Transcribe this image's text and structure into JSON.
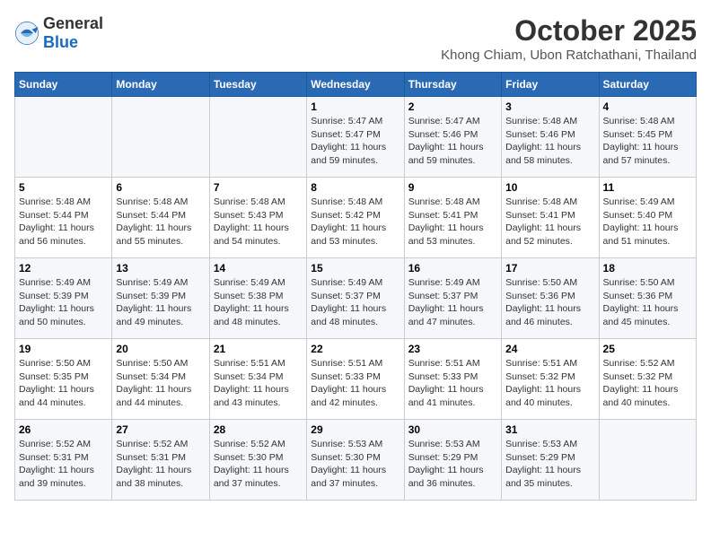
{
  "logo": {
    "general": "General",
    "blue": "Blue"
  },
  "title": "October 2025",
  "subtitle": "Khong Chiam, Ubon Ratchathani, Thailand",
  "headers": [
    "Sunday",
    "Monday",
    "Tuesday",
    "Wednesday",
    "Thursday",
    "Friday",
    "Saturday"
  ],
  "weeks": [
    [
      {
        "day": "",
        "info": ""
      },
      {
        "day": "",
        "info": ""
      },
      {
        "day": "",
        "info": ""
      },
      {
        "day": "1",
        "info": "Sunrise: 5:47 AM\nSunset: 5:47 PM\nDaylight: 11 hours\nand 59 minutes."
      },
      {
        "day": "2",
        "info": "Sunrise: 5:47 AM\nSunset: 5:46 PM\nDaylight: 11 hours\nand 59 minutes."
      },
      {
        "day": "3",
        "info": "Sunrise: 5:48 AM\nSunset: 5:46 PM\nDaylight: 11 hours\nand 58 minutes."
      },
      {
        "day": "4",
        "info": "Sunrise: 5:48 AM\nSunset: 5:45 PM\nDaylight: 11 hours\nand 57 minutes."
      }
    ],
    [
      {
        "day": "5",
        "info": "Sunrise: 5:48 AM\nSunset: 5:44 PM\nDaylight: 11 hours\nand 56 minutes."
      },
      {
        "day": "6",
        "info": "Sunrise: 5:48 AM\nSunset: 5:44 PM\nDaylight: 11 hours\nand 55 minutes."
      },
      {
        "day": "7",
        "info": "Sunrise: 5:48 AM\nSunset: 5:43 PM\nDaylight: 11 hours\nand 54 minutes."
      },
      {
        "day": "8",
        "info": "Sunrise: 5:48 AM\nSunset: 5:42 PM\nDaylight: 11 hours\nand 53 minutes."
      },
      {
        "day": "9",
        "info": "Sunrise: 5:48 AM\nSunset: 5:41 PM\nDaylight: 11 hours\nand 53 minutes."
      },
      {
        "day": "10",
        "info": "Sunrise: 5:48 AM\nSunset: 5:41 PM\nDaylight: 11 hours\nand 52 minutes."
      },
      {
        "day": "11",
        "info": "Sunrise: 5:49 AM\nSunset: 5:40 PM\nDaylight: 11 hours\nand 51 minutes."
      }
    ],
    [
      {
        "day": "12",
        "info": "Sunrise: 5:49 AM\nSunset: 5:39 PM\nDaylight: 11 hours\nand 50 minutes."
      },
      {
        "day": "13",
        "info": "Sunrise: 5:49 AM\nSunset: 5:39 PM\nDaylight: 11 hours\nand 49 minutes."
      },
      {
        "day": "14",
        "info": "Sunrise: 5:49 AM\nSunset: 5:38 PM\nDaylight: 11 hours\nand 48 minutes."
      },
      {
        "day": "15",
        "info": "Sunrise: 5:49 AM\nSunset: 5:37 PM\nDaylight: 11 hours\nand 48 minutes."
      },
      {
        "day": "16",
        "info": "Sunrise: 5:49 AM\nSunset: 5:37 PM\nDaylight: 11 hours\nand 47 minutes."
      },
      {
        "day": "17",
        "info": "Sunrise: 5:50 AM\nSunset: 5:36 PM\nDaylight: 11 hours\nand 46 minutes."
      },
      {
        "day": "18",
        "info": "Sunrise: 5:50 AM\nSunset: 5:36 PM\nDaylight: 11 hours\nand 45 minutes."
      }
    ],
    [
      {
        "day": "19",
        "info": "Sunrise: 5:50 AM\nSunset: 5:35 PM\nDaylight: 11 hours\nand 44 minutes."
      },
      {
        "day": "20",
        "info": "Sunrise: 5:50 AM\nSunset: 5:34 PM\nDaylight: 11 hours\nand 44 minutes."
      },
      {
        "day": "21",
        "info": "Sunrise: 5:51 AM\nSunset: 5:34 PM\nDaylight: 11 hours\nand 43 minutes."
      },
      {
        "day": "22",
        "info": "Sunrise: 5:51 AM\nSunset: 5:33 PM\nDaylight: 11 hours\nand 42 minutes."
      },
      {
        "day": "23",
        "info": "Sunrise: 5:51 AM\nSunset: 5:33 PM\nDaylight: 11 hours\nand 41 minutes."
      },
      {
        "day": "24",
        "info": "Sunrise: 5:51 AM\nSunset: 5:32 PM\nDaylight: 11 hours\nand 40 minutes."
      },
      {
        "day": "25",
        "info": "Sunrise: 5:52 AM\nSunset: 5:32 PM\nDaylight: 11 hours\nand 40 minutes."
      }
    ],
    [
      {
        "day": "26",
        "info": "Sunrise: 5:52 AM\nSunset: 5:31 PM\nDaylight: 11 hours\nand 39 minutes."
      },
      {
        "day": "27",
        "info": "Sunrise: 5:52 AM\nSunset: 5:31 PM\nDaylight: 11 hours\nand 38 minutes."
      },
      {
        "day": "28",
        "info": "Sunrise: 5:52 AM\nSunset: 5:30 PM\nDaylight: 11 hours\nand 37 minutes."
      },
      {
        "day": "29",
        "info": "Sunrise: 5:53 AM\nSunset: 5:30 PM\nDaylight: 11 hours\nand 37 minutes."
      },
      {
        "day": "30",
        "info": "Sunrise: 5:53 AM\nSunset: 5:29 PM\nDaylight: 11 hours\nand 36 minutes."
      },
      {
        "day": "31",
        "info": "Sunrise: 5:53 AM\nSunset: 5:29 PM\nDaylight: 11 hours\nand 35 minutes."
      },
      {
        "day": "",
        "info": ""
      }
    ]
  ]
}
